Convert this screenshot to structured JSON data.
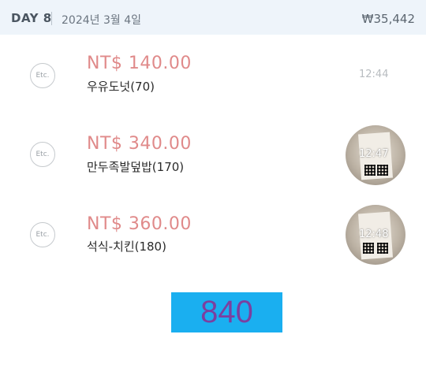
{
  "header": {
    "day": "DAY 8",
    "date": "2024년 3월 4일",
    "total": "₩35,442"
  },
  "expenses": [
    {
      "category": "Etc.",
      "amount": "NT$ 140.00",
      "memo": "우유도넛(70)",
      "time": "12:44",
      "has_receipt": false
    },
    {
      "category": "Etc.",
      "amount": "NT$ 340.00",
      "memo": "만두족발덮밥(170)",
      "time": "12:47",
      "has_receipt": true
    },
    {
      "category": "Etc.",
      "amount": "NT$ 360.00",
      "memo": "석식-치킨(180)",
      "time": "12:48",
      "has_receipt": true
    }
  ],
  "summary": {
    "value": "840"
  },
  "colors": {
    "header_bg": "#eef4fa",
    "amount": "#e08a8a",
    "summary_bg": "#1aaff0",
    "summary_text": "#7b3fa0"
  }
}
